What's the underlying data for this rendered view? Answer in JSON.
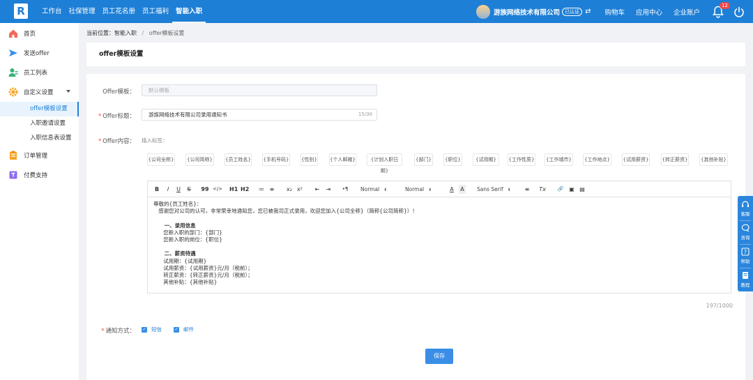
{
  "topbar": {
    "logo_letter": "R",
    "nav": [
      "工作台",
      "社保管理",
      "员工花名册",
      "员工福利",
      "智能入职"
    ],
    "company": "游族网络技术有限公司",
    "cert_label": "已认证",
    "swap_icon": "⇄",
    "links": [
      "购物车",
      "应用中心",
      "企业账户"
    ],
    "notification_count": "12",
    "colors": {
      "primary": "#1e7fd6",
      "badge": "#f04848"
    }
  },
  "sidebar": {
    "items": [
      {
        "label": "首页",
        "icon": "home-icon"
      },
      {
        "label": "发送offer",
        "icon": "send-icon"
      },
      {
        "label": "员工列表",
        "icon": "staff-icon"
      },
      {
        "label": "自定义设置",
        "icon": "gear-icon"
      }
    ],
    "sub_items": [
      "offer模板设置",
      "入职邀请设置",
      "入职信息表设置"
    ],
    "bottom_items": [
      {
        "label": "订单管理",
        "icon": "order-icon"
      },
      {
        "label": "付费支持",
        "icon": "support-icon"
      }
    ]
  },
  "breadcrumb": {
    "prefix": "当前位置：",
    "section": "智能入职",
    "separator": "/",
    "current": "offer模板设置"
  },
  "page_title": "offer模板设置",
  "form": {
    "template_label": "Offer模板：",
    "template_placeholder": "默认模板",
    "title_label": "Offer标题：",
    "title_value": "游族网络技术有限公司录用通知书",
    "title_count": "15/30",
    "content_label": "Offer内容：",
    "insert_hint": "插入标签：",
    "tags": [
      "{公司全称}",
      "{公司简称}",
      "{员工姓名}",
      "{手机号码}",
      "{性别}",
      "{个人邮箱}",
      "{计划入职日期}",
      "{部门}",
      "{职位}",
      "{试用期}",
      "{工作性质}",
      "{工作城市}",
      "{工作地点}",
      "{试用薪资}",
      "{转正薪资}",
      "{其他补贴}"
    ],
    "toolbar": {
      "bold": "B",
      "italic": "I",
      "underline": "U",
      "strike": "S",
      "quote": "99",
      "code": "</>",
      "h1": "H1",
      "h2": "H2",
      "ordered_list": "≔",
      "bullet_list": "≡",
      "subscript": "x₂",
      "superscript": "x²",
      "outdent": "⇤",
      "indent": "⇥",
      "direction": "•¶",
      "size_select": "Normal",
      "header_select": "Normal",
      "font_color": "A",
      "bg_color": "A",
      "font_select": "Sans Serif",
      "align": "≡",
      "clean": "Tx",
      "link": "🔗",
      "image": "▣",
      "video": "▤"
    },
    "content_lines": [
      "尊敬的{员工姓名}：",
      "   感谢您对公司的认可，非常荣幸地通知您，您已被我司正式录用，欢迎您加入{公司全称}（简称{公司简称}）！",
      "",
      "      一、录用信息",
      "      您新入职的部门：{部门}",
      "      您新入职的岗位：{职位}",
      "",
      "      二、薪资待遇",
      "      试用期：{试用期}",
      "      试用薪资：{试用薪资}元/月（税前）；",
      "      转正薪资：{转正薪资}元/月（税前）；",
      "      其他补贴：{其他补贴}"
    ],
    "content_count": "197/1000",
    "notify_label": "通知方式：",
    "notify_options": [
      "短信",
      "邮件"
    ],
    "save_label": "保存"
  },
  "float_panel": [
    "客服",
    "咨询",
    "帮助",
    "教程"
  ]
}
